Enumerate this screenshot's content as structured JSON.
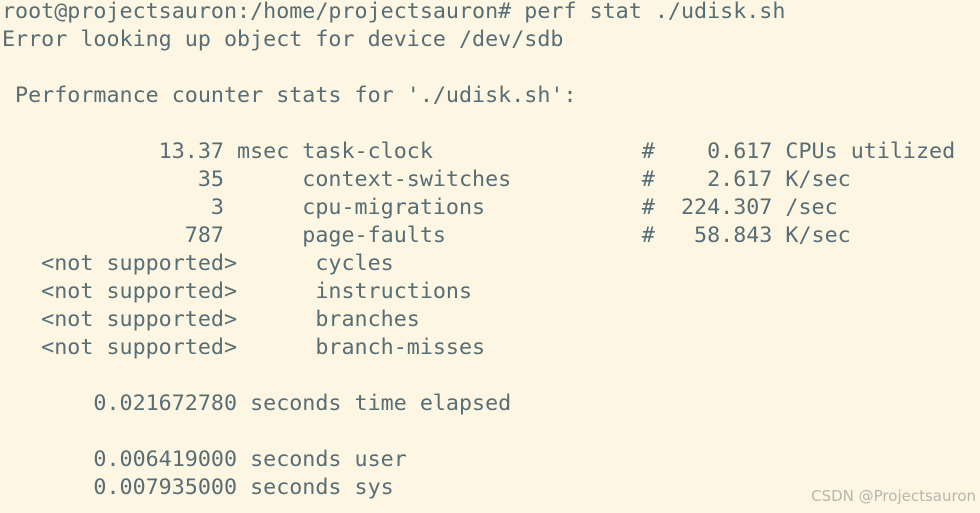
{
  "terminal": {
    "prompt": "root@projectsauron:/home/projectsauron# perf stat ./udisk.sh",
    "error": "Error looking up object for device /dev/sdb",
    "header": " Performance counter stats for './udisk.sh':",
    "stats": [
      "            13.37 msec task-clock                #    0.617 CPUs utilized",
      "               35      context-switches          #    2.617 K/sec",
      "                3      cpu-migrations            #  224.307 /sec",
      "              787      page-faults               #   58.843 K/sec",
      "   <not supported>      cycles",
      "   <not supported>      instructions",
      "   <not supported>      branches",
      "   <not supported>      branch-misses"
    ],
    "time_elapsed": "       0.021672780 seconds time elapsed",
    "time_user": "       0.006419000 seconds user",
    "time_sys": "       0.007935000 seconds sys"
  },
  "watermark": "CSDN @Projectsauron"
}
